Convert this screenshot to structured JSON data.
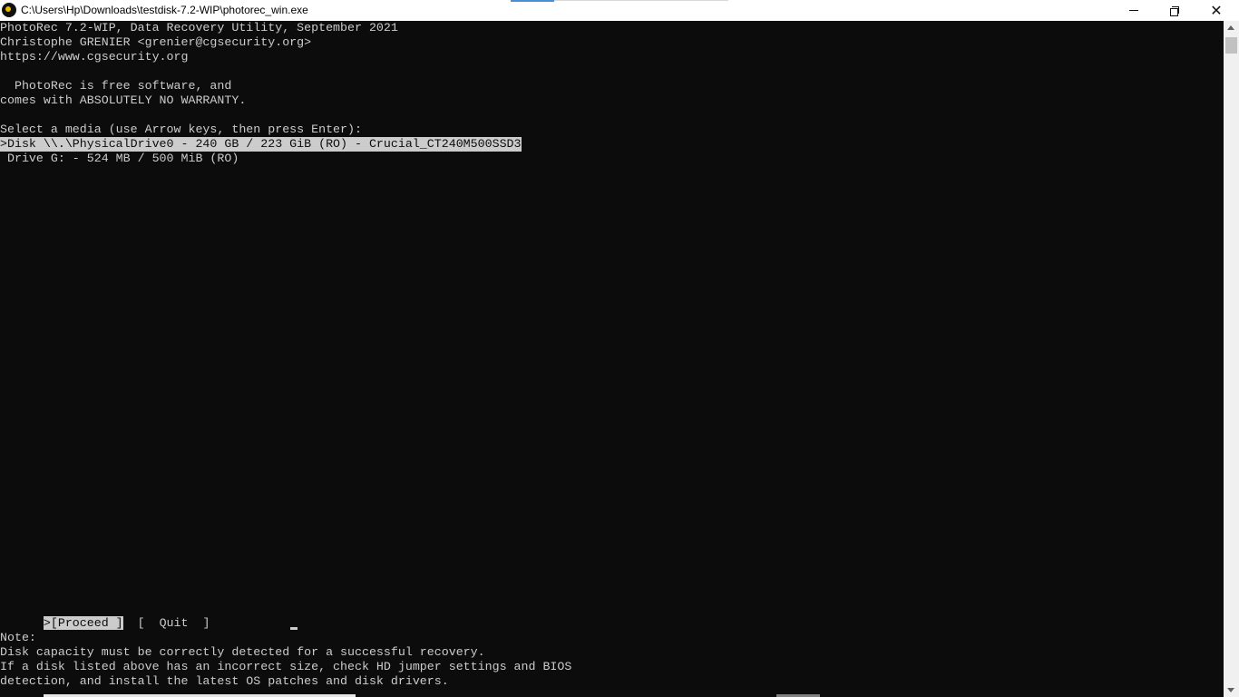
{
  "window": {
    "title": "C:\\Users\\Hp\\Downloads\\testdisk-7.2-WIP\\photorec_win.exe",
    "icon": "photorec-app-icon"
  },
  "console": {
    "header": [
      "PhotoRec 7.2-WIP, Data Recovery Utility, September 2021",
      "Christophe GRENIER <grenier@cgsecurity.org>",
      "https://www.cgsecurity.org"
    ],
    "license": [
      "  PhotoRec is free software, and",
      "comes with ABSOLUTELY NO WARRANTY."
    ],
    "prompt": "Select a media (use Arrow keys, then press Enter):",
    "media": [
      {
        "label": ">Disk \\\\.\\PhysicalDrive0 - 240 GB / 223 GiB (RO) - Crucial_CT240M500SSD3",
        "selected": true
      },
      {
        "label": " Drive G: - 524 MB / 500 MiB (RO)",
        "selected": false
      }
    ],
    "actions": {
      "proceed": ">[Proceed ]",
      "quit": "[  Quit  ]"
    },
    "note": {
      "heading": "Note:",
      "lines": [
        "Disk capacity must be correctly detected for a successful recovery.",
        "If a disk listed above has an incorrect size, check HD jumper settings and BIOS",
        "detection, and install the latest OS patches and disk drivers."
      ]
    }
  },
  "colors": {
    "background": "#0c0c0c",
    "text": "#cccccc",
    "highlight_bg": "#cccccc",
    "highlight_text": "#0c0c0c"
  }
}
